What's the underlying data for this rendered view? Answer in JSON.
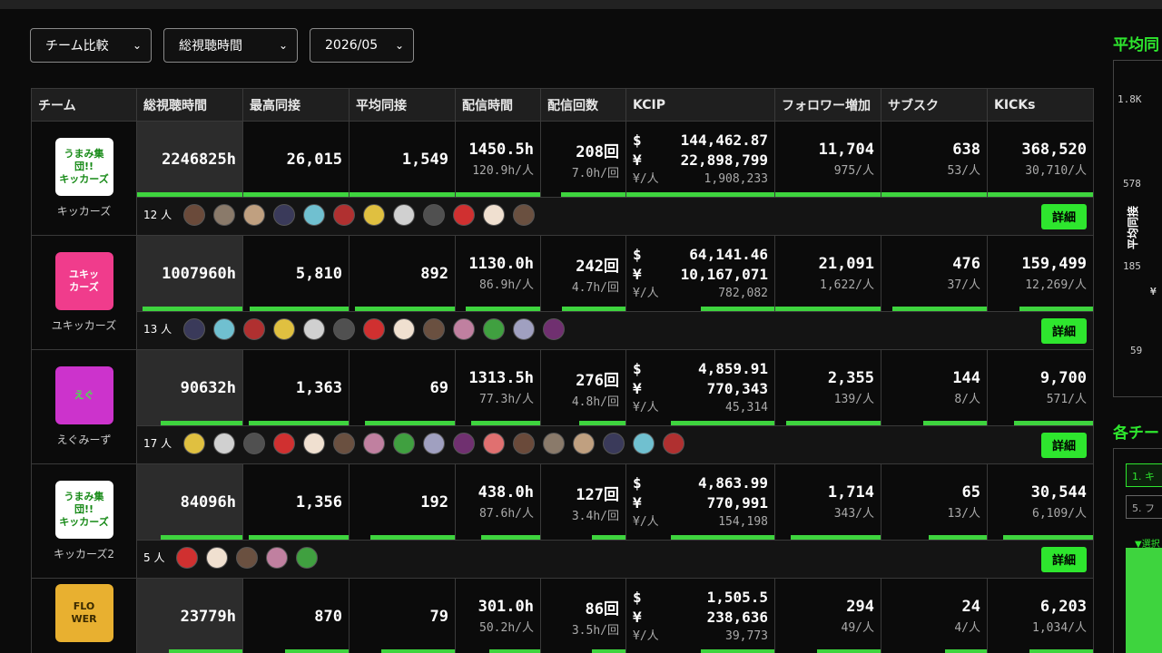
{
  "filters": {
    "team": "チーム比較",
    "metric": "総視聴時間",
    "month": "2026/05"
  },
  "headers": [
    "チーム",
    "総視聴時間",
    "最高同接",
    "平均同接",
    "配信時間",
    "配信回数",
    "KCIP",
    "フォロワー増加",
    "サブスク",
    "KICKs"
  ],
  "detail_label": "詳細",
  "teams": [
    {
      "logo_text": "うまみ集団!!\nキッカーズ",
      "name": "キッカーズ",
      "logo_bg": "#ffffff",
      "logo_fg": "#178a17",
      "total": "2246825h",
      "peak": "26,015",
      "avg": "1,549",
      "hours": "1450.5h",
      "hours_per": "120.9h/人",
      "streams": "208回",
      "streams_per": "7.0h/回",
      "kcip_usd": "144,462.87",
      "kcip_jpy": "22,898,799",
      "kcip_per": "1,908,233",
      "followers": "11,704",
      "followers_per": "975/人",
      "subs": "638",
      "subs_per": "53/人",
      "kicks": "368,520",
      "kicks_per": "30,710/人",
      "members": "12 人",
      "member_count": 12,
      "bars": [
        1.0,
        1.0,
        1.0,
        1.0,
        0.76,
        1.0,
        1.0,
        1.0,
        1.0
      ]
    },
    {
      "logo_text": "ユキッ\nカーズ",
      "name": "ユキッカーズ",
      "logo_bg": "#f03c8c",
      "logo_fg": "#ffffff",
      "total": "1007960h",
      "peak": "5,810",
      "avg": "892",
      "hours": "1130.0h",
      "hours_per": "86.9h/人",
      "streams": "242回",
      "streams_per": "4.7h/回",
      "kcip_usd": "64,141.46",
      "kcip_jpy": "10,167,071",
      "kcip_per": "782,082",
      "followers": "21,091",
      "followers_per": "1,622/人",
      "subs": "476",
      "subs_per": "37/人",
      "kicks": "159,499",
      "kicks_per": "12,269/人",
      "members": "13 人",
      "member_count": 13,
      "bars": [
        0.95,
        0.94,
        0.95,
        0.88,
        0.75,
        0.5,
        1.0,
        0.9,
        0.7
      ]
    },
    {
      "logo_text": "えぐ",
      "name": "えぐみーず",
      "logo_bg": "#cc33cc",
      "logo_fg": "#4de04d",
      "total": "90632h",
      "peak": "1,363",
      "avg": "69",
      "hours": "1313.5h",
      "hours_per": "77.3h/人",
      "streams": "276回",
      "streams_per": "4.8h/回",
      "kcip_usd": "4,859.91",
      "kcip_jpy": "770,343",
      "kcip_per": "45,314",
      "followers": "2,355",
      "followers_per": "139/人",
      "subs": "144",
      "subs_per": "8/人",
      "kicks": "9,700",
      "kicks_per": "571/人",
      "members": "17 人",
      "member_count": 17,
      "bars": [
        0.78,
        0.95,
        0.85,
        0.82,
        0.55,
        0.7,
        0.9,
        0.6,
        0.75
      ]
    },
    {
      "logo_text": "うまみ集団!!\nキッカーズ",
      "name": "キッカーズ2",
      "logo_bg": "#ffffff",
      "logo_fg": "#178a17",
      "total": "84096h",
      "peak": "1,356",
      "avg": "192",
      "hours": "438.0h",
      "hours_per": "87.6h/人",
      "streams": "127回",
      "streams_per": "3.4h/回",
      "kcip_usd": "4,863.99",
      "kcip_jpy": "770,991",
      "kcip_per": "154,198",
      "followers": "1,714",
      "followers_per": "343/人",
      "subs": "65",
      "subs_per": "13/人",
      "kicks": "30,544",
      "kicks_per": "6,109/人",
      "members": "5 人",
      "member_count": 5,
      "bars": [
        0.78,
        0.95,
        0.8,
        0.7,
        0.4,
        0.7,
        0.85,
        0.55,
        0.85
      ]
    },
    {
      "logo_text": "FLO\nWER",
      "name": "",
      "logo_bg": "#e8b030",
      "logo_fg": "#3a2a00",
      "total": "23779h",
      "peak": "870",
      "avg": "79",
      "hours": "301.0h",
      "hours_per": "50.2h/人",
      "streams": "86回",
      "streams_per": "3.5h/回",
      "kcip_usd": "1,505.5",
      "kcip_jpy": "238,636",
      "kcip_per": "39,773",
      "followers": "294",
      "followers_per": "49/人",
      "subs": "24",
      "subs_per": "4/人",
      "kicks": "6,203",
      "kicks_per": "1,034/人",
      "members": "",
      "member_count": 0,
      "bars": [
        0.7,
        0.6,
        0.7,
        0.6,
        0.4,
        0.5,
        0.6,
        0.4,
        0.6
      ]
    }
  ],
  "right_panel": {
    "title": "平均同",
    "ticks": [
      "1.8K",
      "578",
      "185",
      "59"
    ],
    "ylabel": "平均同接",
    "yen": "¥",
    "title2": "各チー",
    "chip1": "1. キ",
    "chip2": "5. フ",
    "note": "▼選択"
  },
  "colors": {
    "accent": "#2ee62e",
    "bar": "#3ed43e"
  }
}
